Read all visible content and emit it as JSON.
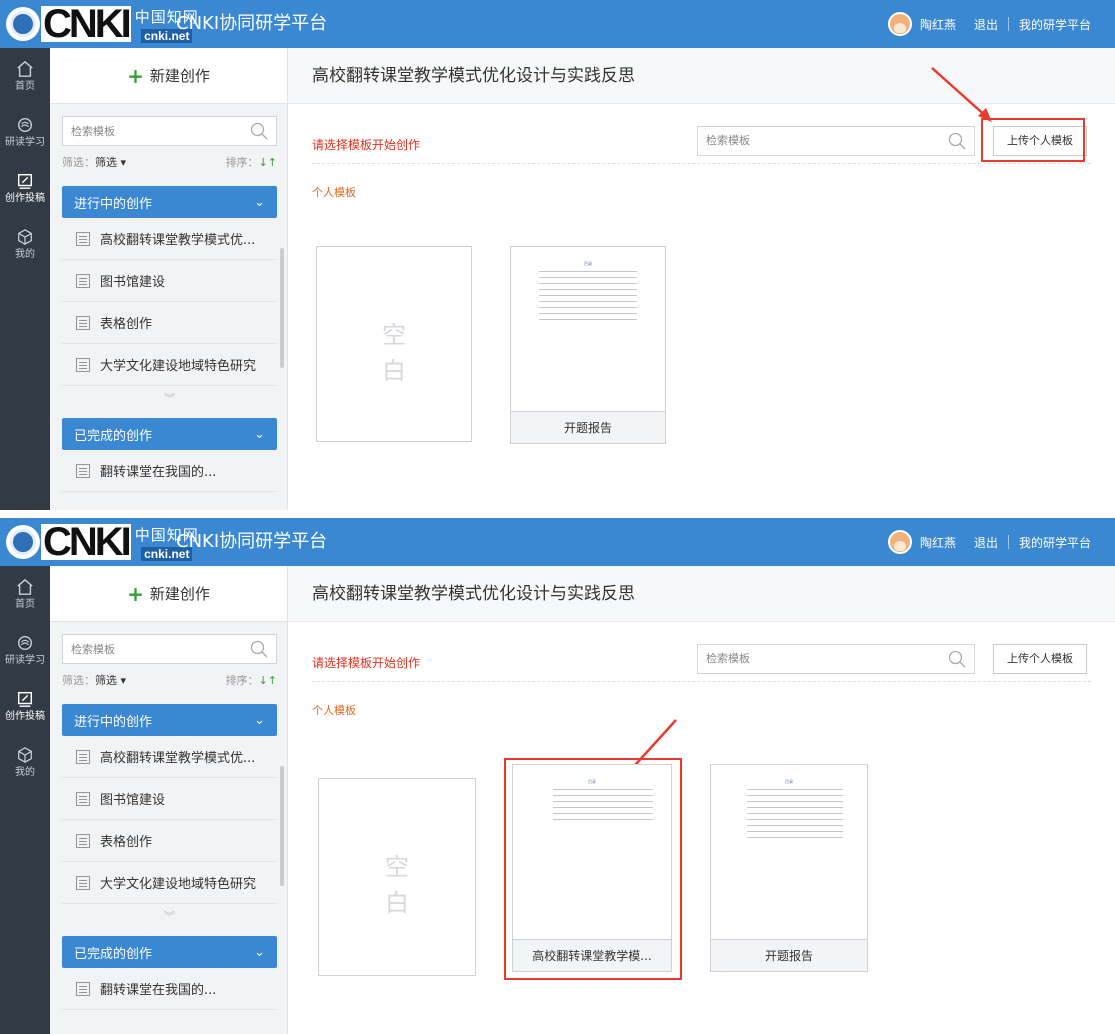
{
  "app": {
    "logo_cn": "中国知网",
    "logo_en": "cnki.net",
    "logo_brand": "CNKI",
    "title": "CNKI协同研学平台"
  },
  "user": {
    "name": "陶红燕",
    "logout": "退出",
    "my_platform": "我的研学平台"
  },
  "leftnav": [
    {
      "label": "首页",
      "icon": "home-icon"
    },
    {
      "label": "研读学习",
      "icon": "reading-icon"
    },
    {
      "label": "创作投稿",
      "icon": "writing-icon"
    },
    {
      "label": "我的",
      "icon": "profile-icon"
    }
  ],
  "sidebar": {
    "new_label": "新建创作",
    "search_placeholder": "检索模板",
    "filter_label": "筛选：",
    "filter_value": "筛选 ▾",
    "sort_label": "排序：",
    "sort_arrow": "↓↑",
    "in_progress_header": "进行中的创作",
    "in_progress": [
      "高校翻转课堂教学模式优...",
      "图书馆建设",
      "表格创作",
      "大学文化建设地域特色研究"
    ],
    "completed_header": "已完成的创作",
    "completed": [
      "翻转课堂在我国的..."
    ]
  },
  "main": {
    "doc_title": "高校翻转课堂教学模式优化设计与实践反思",
    "choose_label": "请选择模板开始创作",
    "search_placeholder": "检索模板",
    "upload_label": "上传个人模板",
    "section_label": "个人模板",
    "blank_label_1": "空",
    "blank_label_2": "白",
    "thumb_title": "目录"
  },
  "panel1": {
    "templates": [
      "开题报告"
    ]
  },
  "panel2": {
    "templates": [
      "高校翻转课堂教学模...",
      "开题报告"
    ]
  },
  "colors": {
    "topbar": "#3a87d2",
    "nav_dark": "#323a45",
    "highlight": "#e83a2f",
    "accent_red": "#e0301e"
  }
}
